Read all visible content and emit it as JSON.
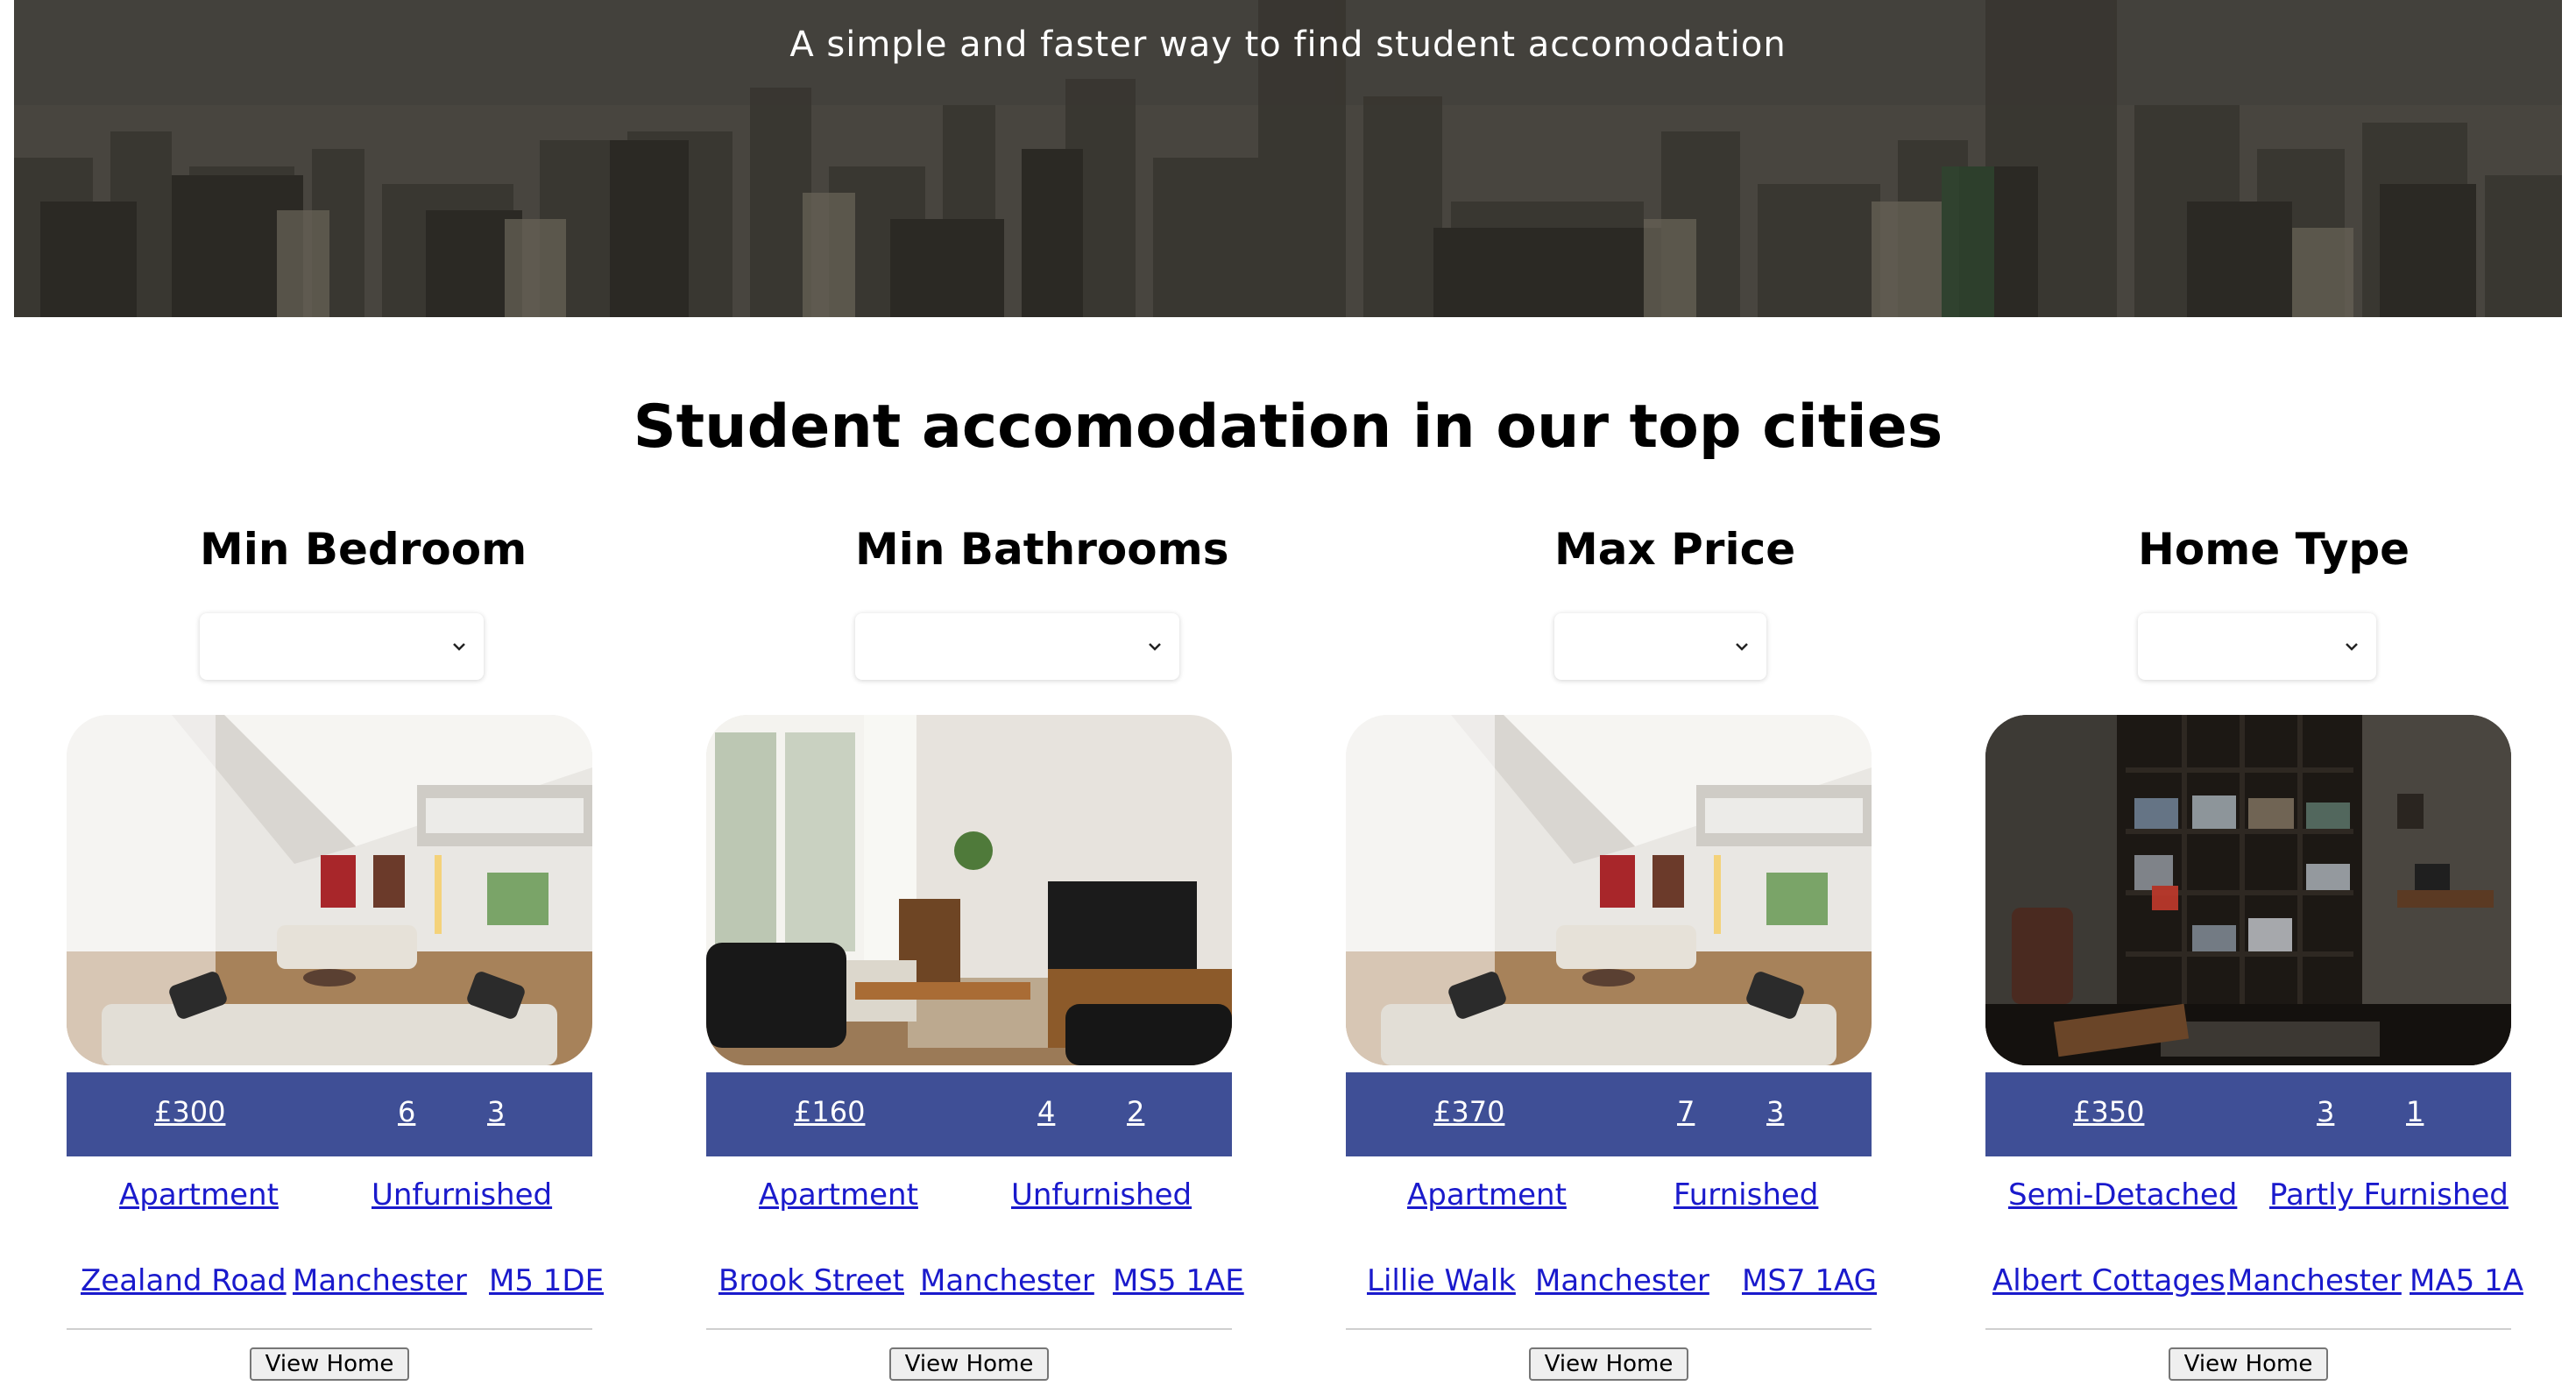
{
  "hero": {
    "tagline": "A simple and faster way to find student accomodation"
  },
  "section": {
    "title": "Student accomodation in our top cities"
  },
  "filters": [
    {
      "label": "Min Bedroom",
      "value": ""
    },
    {
      "label": "Min Bathrooms",
      "value": ""
    },
    {
      "label": "Max Price",
      "value": ""
    },
    {
      "label": "Home Type",
      "value": ""
    }
  ],
  "listings": [
    {
      "price": "£300",
      "bedrooms": "6",
      "bathrooms": "3",
      "type": "Apartment",
      "furnishing": "Unfurnished",
      "street": "Zealand Road",
      "city": "Manchester",
      "postcode": "M5 1DE",
      "button": "View Home",
      "photo": "bright-living-room"
    },
    {
      "price": "£160",
      "bedrooms": "4",
      "bathrooms": "2",
      "type": "Apartment",
      "furnishing": "Unfurnished",
      "street": "Brook Street",
      "city": "Manchester",
      "postcode": "MS5 1AE",
      "button": "View Home",
      "photo": "living-room-with-tv"
    },
    {
      "price": "£370",
      "bedrooms": "7",
      "bathrooms": "3",
      "type": "Apartment",
      "furnishing": "Furnished",
      "street": "Lillie Walk",
      "city": "Manchester",
      "postcode": "MS7 1AG",
      "button": "View Home",
      "photo": "bright-living-room"
    },
    {
      "price": "£350",
      "bedrooms": "3",
      "bathrooms": "1",
      "type": "Semi-Detached",
      "furnishing": "Partly Furnished",
      "street": "Albert Cottages",
      "city": "Manchester",
      "postcode": "MA5 1A",
      "button": "View Home",
      "photo": "dark-study-bookshelf"
    }
  ],
  "colors": {
    "info_bar": "#3f4f96",
    "link": "#1a1acc"
  }
}
